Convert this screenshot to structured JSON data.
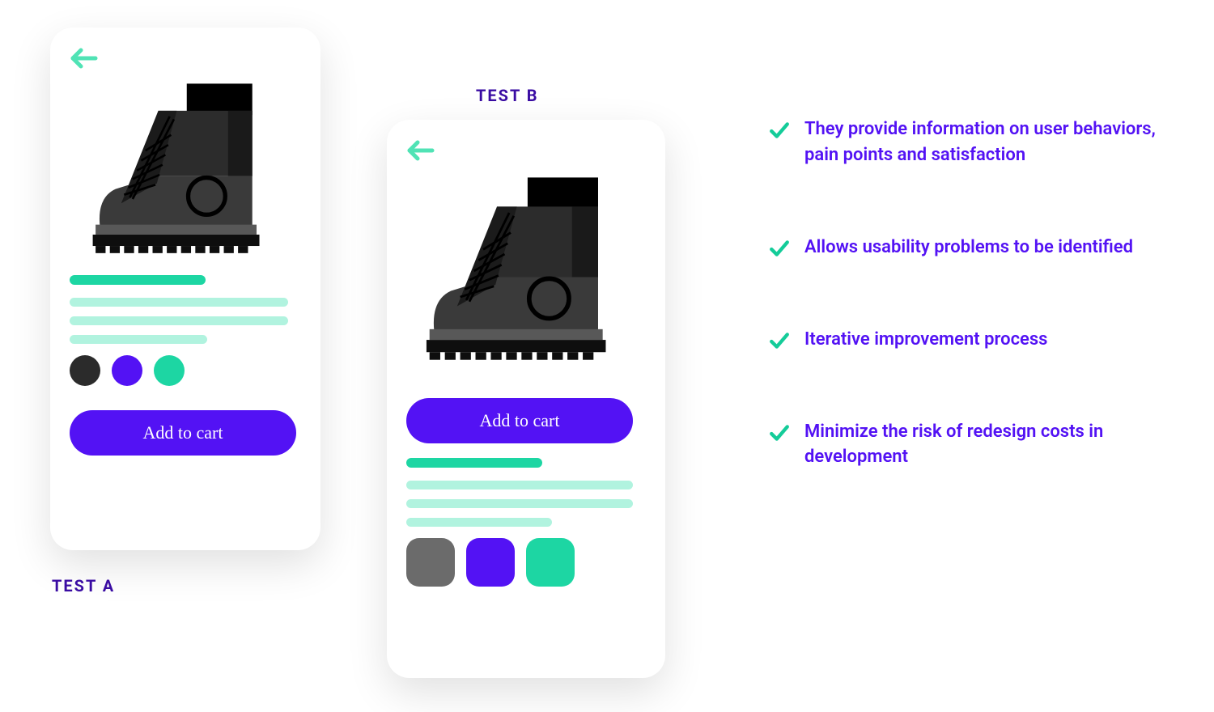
{
  "labels": {
    "test_a": "TEST A",
    "test_b": "TEST B"
  },
  "phone_a": {
    "cta": "Add to cart",
    "swatch_colors": [
      "#2b2b2b",
      "#5312f4",
      "#1dd6a3"
    ]
  },
  "phone_b": {
    "cta": "Add to cart",
    "swatch_colors": [
      "#6b6b6b",
      "#5312f4",
      "#1dd6a3"
    ]
  },
  "benefits": [
    "They provide information on user behaviors, pain points and satisfaction",
    "Allows usability problems to be identified",
    "Iterative improvement process",
    "Minimize the risk of redesign costs in development"
  ],
  "colors": {
    "accent": "#5312f4",
    "mint": "#1dd6a3",
    "mint_light": "#b1f3df",
    "check": "#14cc99"
  }
}
